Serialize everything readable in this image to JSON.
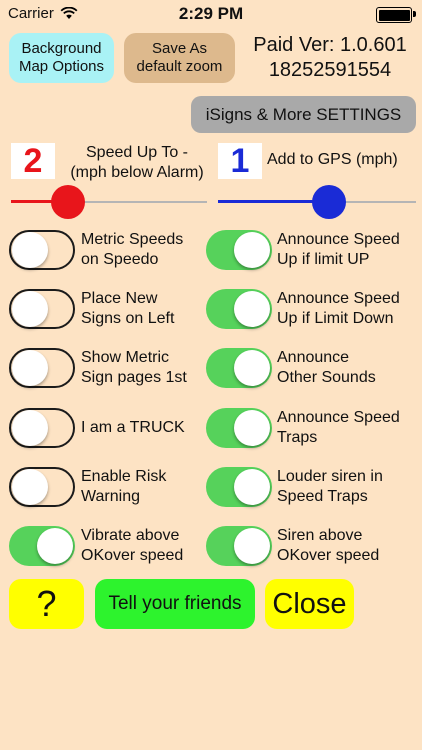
{
  "status_bar": {
    "carrier": "Carrier",
    "time": "2:29 PM",
    "wifi_icon": "wifi-icon",
    "battery_icon": "battery-icon"
  },
  "header": {
    "background_button": "Background\nMap Options",
    "zoom_button": "Save As\ndefault zoom",
    "paid_version": "Paid Ver: 1.0.601",
    "device_id": "18252591554",
    "isigns_button": "iSigns & More SETTINGS"
  },
  "speed_up": {
    "value": "2",
    "label": "Speed Up To -\n(mph below Alarm)",
    "color": "#e8151b",
    "slider_fraction": 0.29
  },
  "gps": {
    "value": "1",
    "label": "Add to GPS (mph)",
    "color": "#1a2bd6",
    "slider_fraction": 0.56
  },
  "toggles_left": [
    {
      "label": "Metric Speeds\non Speedo",
      "on": false
    },
    {
      "label": "Place New\nSigns on Left",
      "on": false
    },
    {
      "label": "Show Metric\nSign pages 1st",
      "on": false
    },
    {
      "label": "I am a TRUCK",
      "on": false
    },
    {
      "label": "Enable Risk\nWarning",
      "on": false
    },
    {
      "label": "Vibrate above\nOKover speed",
      "on": true
    }
  ],
  "toggles_right": [
    {
      "label": "Announce Speed\nUp if limit UP",
      "on": true
    },
    {
      "label": "Announce Speed\nUp if Limit Down",
      "on": true
    },
    {
      "label": "Announce\nOther Sounds",
      "on": true
    },
    {
      "label": "Announce Speed\nTraps",
      "on": true
    },
    {
      "label": "Louder siren in\nSpeed Traps",
      "on": true
    },
    {
      "label": "Siren above\nOKover speed",
      "on": true
    }
  ],
  "footer": {
    "help_button": "?",
    "tell_friends_button": "Tell your friends",
    "close_button": "Close"
  },
  "colors": {
    "background": "#fde3c4",
    "toggle_on": "#56d25b"
  }
}
